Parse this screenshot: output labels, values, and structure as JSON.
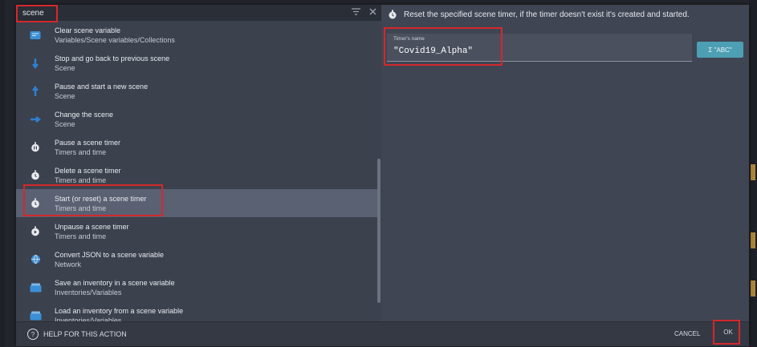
{
  "search": {
    "value": "scene",
    "filter_icon": "filter-icon",
    "close_icon": "close-icon"
  },
  "actions": [
    {
      "title": "Clear scene variable",
      "category": "Variables/Scene variables/Collections",
      "icon": "variable-icon",
      "color": "#3b8fd6",
      "selected": false
    },
    {
      "title": "Stop and go back to previous scene",
      "category": "Scene",
      "icon": "arrow-down-icon",
      "color": "#2f7fd0",
      "selected": false
    },
    {
      "title": "Pause and start a new scene",
      "category": "Scene",
      "icon": "arrow-up-icon",
      "color": "#2f7fd0",
      "selected": false
    },
    {
      "title": "Change the scene",
      "category": "Scene",
      "icon": "arrow-right-icon",
      "color": "#2f7fd0",
      "selected": false
    },
    {
      "title": "Pause a scene timer",
      "category": "Timers and time",
      "icon": "timer-pause-icon",
      "color": "#e8eaf0",
      "selected": false
    },
    {
      "title": "Delete a scene timer",
      "category": "Timers and time",
      "icon": "timer-icon",
      "color": "#e8eaf0",
      "selected": false
    },
    {
      "title": "Start (or reset) a scene timer",
      "category": "Timers and time",
      "icon": "timer-icon",
      "color": "#e8eaf0",
      "selected": true
    },
    {
      "title": "Unpause a scene timer",
      "category": "Timers and time",
      "icon": "timer-play-icon",
      "color": "#e8eaf0",
      "selected": false
    },
    {
      "title": "Convert JSON to a scene variable",
      "category": "Network",
      "icon": "globe-icon",
      "color": "#3b8fd6",
      "selected": false
    },
    {
      "title": "Save an inventory in a scene variable",
      "category": "Inventories/Variables",
      "icon": "inventory-icon",
      "color": "#3b8fd6",
      "selected": false
    },
    {
      "title": "Load an inventory from a scene variable",
      "category": "Inventories/Variables",
      "icon": "inventory-icon",
      "color": "#3b8fd6",
      "selected": false
    }
  ],
  "detail": {
    "description": "Reset the specified scene timer, if the timer doesn't exist it's created and started.",
    "field_label": "Timer's name",
    "field_value": "\"Covid19_Alpha\"",
    "expression_button": "Σ \"ABC\""
  },
  "footer": {
    "help": "HELP FOR THIS ACTION",
    "cancel": "CANCEL",
    "ok": "OK"
  },
  "colors": {
    "highlight": "#d4282c",
    "selected_row": "#5a6172",
    "accent": "#4d9fb3"
  }
}
